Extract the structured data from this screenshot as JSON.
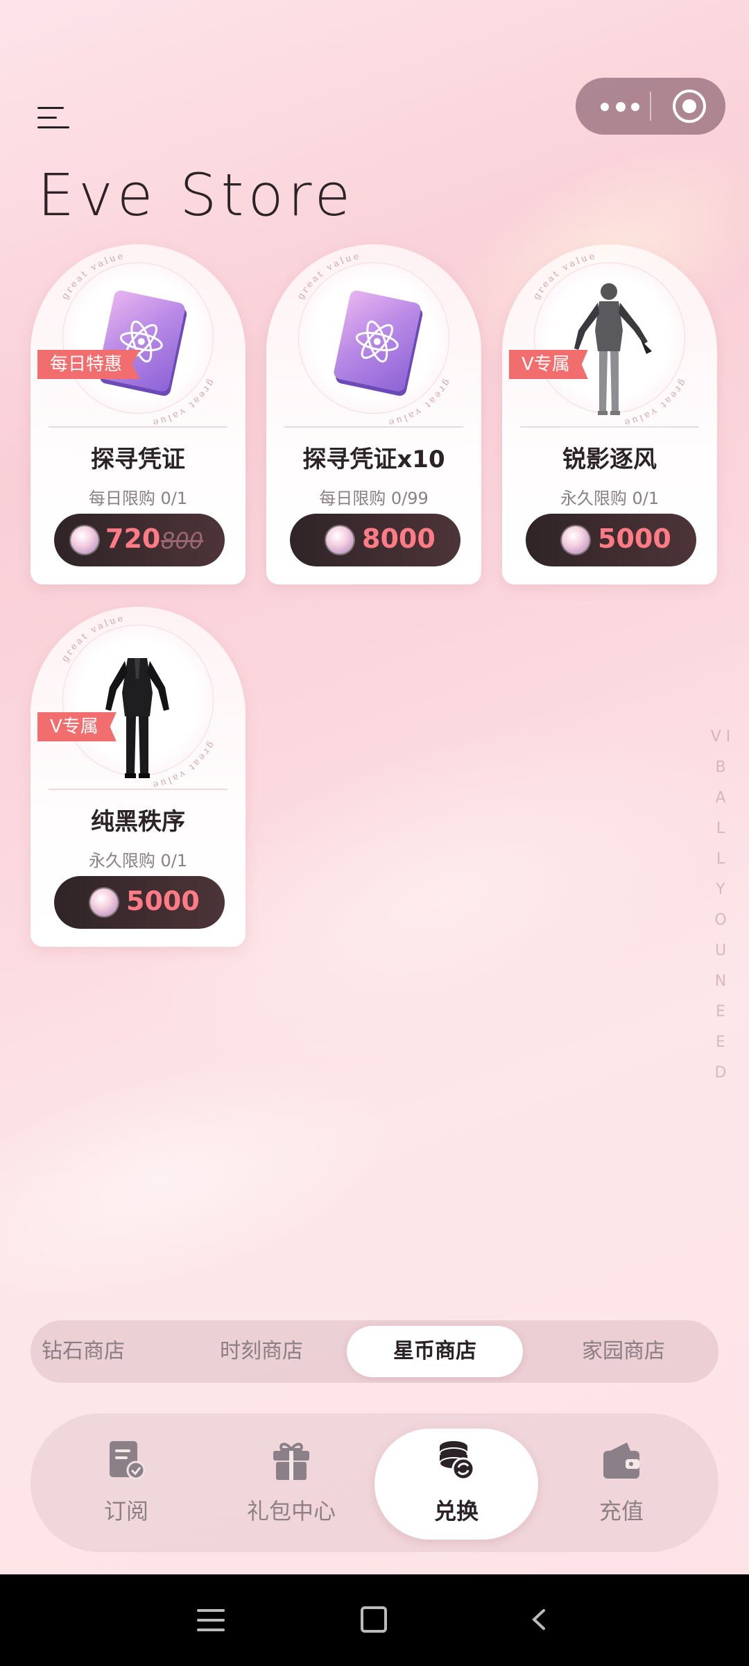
{
  "header": {
    "title": "Eve Store"
  },
  "products": [
    {
      "tag": "每日特惠",
      "name": "探寻凭证",
      "limit": "每日限购 0/1",
      "price": "720",
      "original_price": "800"
    },
    {
      "tag": "",
      "name": "探寻凭证x10",
      "limit": "每日限购 0/99",
      "price": "8000",
      "original_price": ""
    },
    {
      "tag": "V专属",
      "name": "锐影逐风",
      "limit": "永久限购 0/1",
      "price": "5000",
      "original_price": ""
    },
    {
      "tag": "V专属",
      "name": "纯黑秩序",
      "limit": "永久限购 0/1",
      "price": "5000",
      "original_price": ""
    }
  ],
  "ring_text": "great value",
  "shop_tabs": [
    {
      "label": "钻石商店",
      "active": false
    },
    {
      "label": "时刻商店",
      "active": false
    },
    {
      "label": "星币商店",
      "active": true
    },
    {
      "label": "家园商店",
      "active": false
    }
  ],
  "bottom_nav": [
    {
      "label": "订阅",
      "icon": "subscription-icon",
      "active": false
    },
    {
      "label": "礼包中心",
      "icon": "gift-icon",
      "active": false
    },
    {
      "label": "兑换",
      "icon": "coin-exchange-icon",
      "active": true
    },
    {
      "label": "充值",
      "icon": "wallet-icon",
      "active": false
    }
  ],
  "side_text": "V I B A L L Y O U N E E D",
  "colors": {
    "tag": "#f26e6e",
    "price": "#ff7b85",
    "button": "#2f2427"
  }
}
